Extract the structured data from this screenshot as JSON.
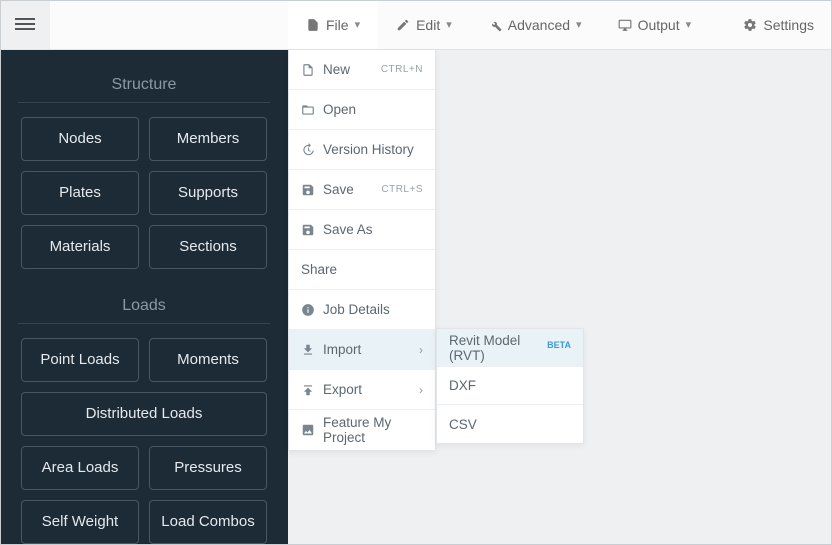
{
  "topbar": {
    "items": [
      {
        "label": "File"
      },
      {
        "label": "Edit"
      },
      {
        "label": "Advanced"
      },
      {
        "label": "Output"
      },
      {
        "label": "Settings"
      }
    ]
  },
  "sidebar": {
    "sections": [
      {
        "title": "Structure",
        "buttons": [
          "Nodes",
          "Members",
          "Plates",
          "Supports",
          "Materials",
          "Sections"
        ]
      },
      {
        "title": "Loads",
        "buttons": [
          "Point Loads",
          "Moments",
          "Distributed Loads",
          "Area Loads",
          "Pressures",
          "Self Weight",
          "Load Combos"
        ]
      }
    ]
  },
  "file_menu": {
    "items": [
      {
        "label": "New",
        "shortcut": "CTRL+N"
      },
      {
        "label": "Open"
      },
      {
        "label": "Version History"
      },
      {
        "label": "Save",
        "shortcut": "CTRL+S"
      },
      {
        "label": "Save As"
      },
      {
        "label": "Share"
      },
      {
        "label": "Job Details"
      },
      {
        "label": "Import",
        "submenu": true,
        "selected": true
      },
      {
        "label": "Export",
        "submenu": true
      },
      {
        "label": "Feature My Project"
      }
    ]
  },
  "import_submenu": {
    "items": [
      {
        "label": "Revit Model (RVT)",
        "badge": "BETA",
        "selected": true
      },
      {
        "label": "DXF"
      },
      {
        "label": "CSV"
      }
    ]
  }
}
